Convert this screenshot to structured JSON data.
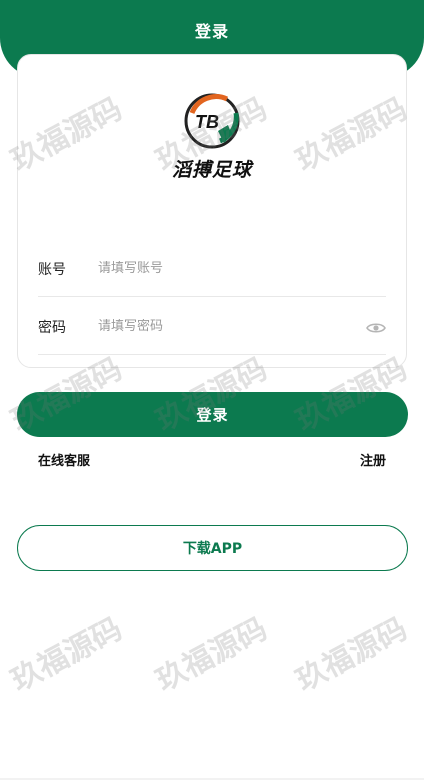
{
  "header": {
    "title": "登录"
  },
  "brand": {
    "logo_initials": "TB",
    "name": "滔搏足球"
  },
  "form": {
    "account": {
      "label": "账号",
      "placeholder": "请填写账号",
      "value": ""
    },
    "password": {
      "label": "密码",
      "placeholder": "请填写密码",
      "value": ""
    }
  },
  "actions": {
    "login_label": "登录",
    "service_label": "在线客服",
    "register_label": "注册",
    "download_label": "下载APP"
  },
  "watermark": {
    "text": "玖福源码"
  },
  "colors": {
    "brand_green": "#0c7a4f",
    "logo_orange": "#e2651f"
  },
  "icons": {
    "password_toggle": "eye-icon"
  }
}
